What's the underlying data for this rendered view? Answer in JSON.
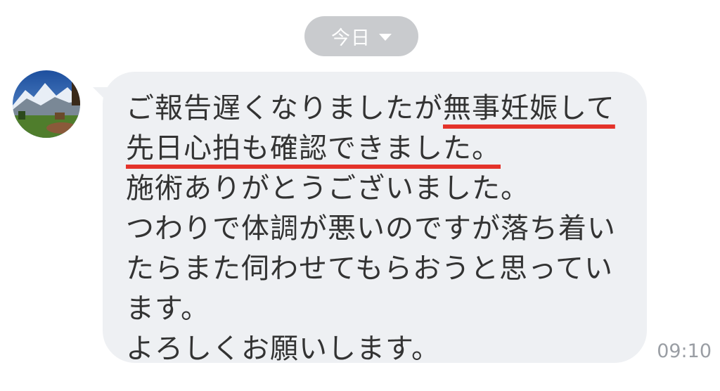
{
  "date_divider": {
    "label": "今日",
    "icon": "chevron-down-icon"
  },
  "message": {
    "sender_avatar": "avatar",
    "lines": [
      {
        "before": "ご報告遅くなりましたが",
        "highlight": "無事妊娠して",
        "after": ""
      },
      {
        "before": "",
        "highlight": "先日心拍も確認できました。",
        "after": ""
      },
      {
        "before": "施術ありがとうございました。",
        "highlight": "",
        "after": ""
      },
      {
        "before": "つわりで体調が悪いのですが落ち着い",
        "highlight": "",
        "after": ""
      },
      {
        "before": "たらまた伺わせてもらおうと思ってい",
        "highlight": "",
        "after": ""
      },
      {
        "before": "ます。",
        "highlight": "",
        "after": ""
      },
      {
        "before": "よろしくお願いします。",
        "highlight": "",
        "after": ""
      }
    ],
    "timestamp": "09:10"
  },
  "colors": {
    "bubble_bg": "#eef0f3",
    "pill_bg": "#c9cbce",
    "underline": "#e4332a",
    "text": "#333333",
    "timestamp": "#9a9ea4"
  }
}
